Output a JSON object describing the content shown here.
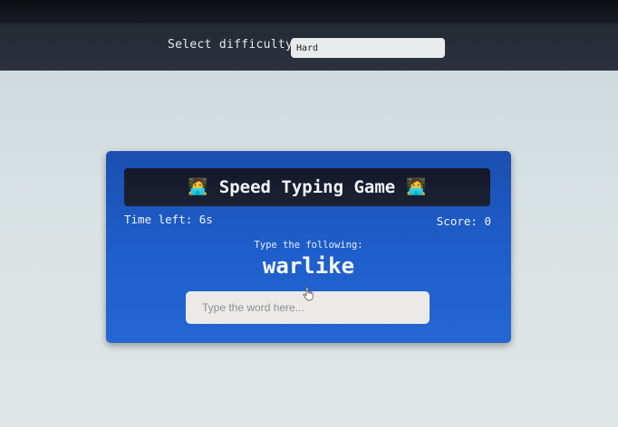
{
  "settings": {
    "label": "Select difficulty",
    "difficulty_value": "Hard"
  },
  "game": {
    "title": "Speed Typing Game",
    "title_icon": "technologist-emoji",
    "title_icon_glyph": "🧑‍💻",
    "time_left": "Time left: 6s",
    "score": "Score: 0",
    "prompt": "Type the following:",
    "word": "warlike",
    "input_placeholder": "Type the word here..."
  },
  "colors": {
    "card_blue": "#1e5fcc",
    "title_bar": "#14182a",
    "settings_bar": "#2c333e"
  }
}
